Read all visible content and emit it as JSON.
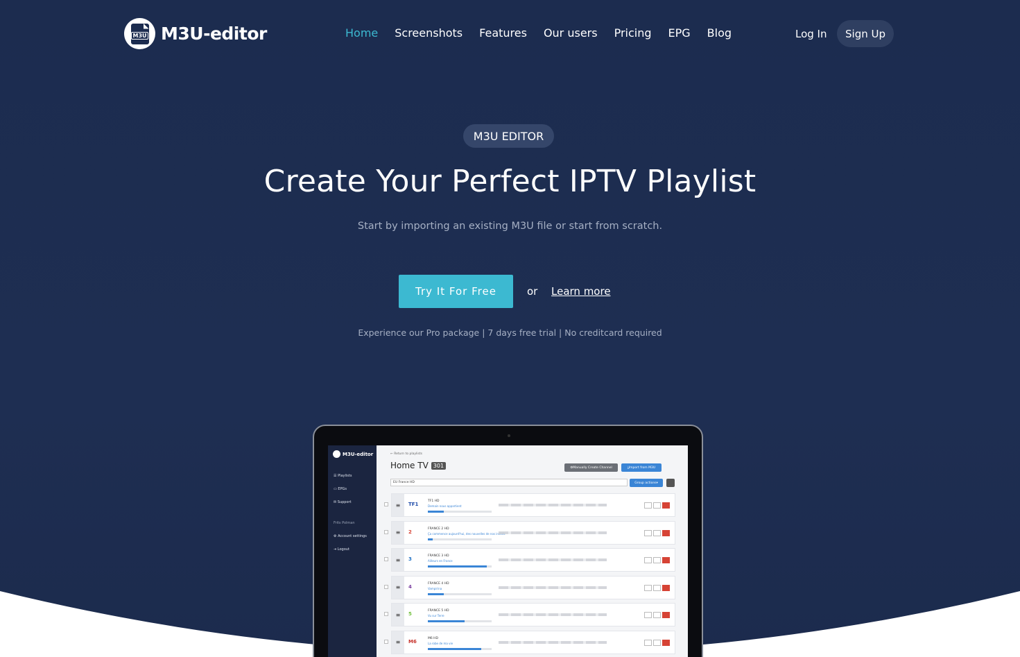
{
  "brand": {
    "name": "M3U-editor",
    "icon_text": "M3U"
  },
  "nav": {
    "items": [
      {
        "label": "Home",
        "active": true
      },
      {
        "label": "Screenshots",
        "active": false
      },
      {
        "label": "Features",
        "active": false
      },
      {
        "label": "Our users",
        "active": false
      },
      {
        "label": "Pricing",
        "active": false
      },
      {
        "label": "EPG",
        "active": false
      },
      {
        "label": "Blog",
        "active": false
      }
    ],
    "login_label": "Log In",
    "signup_label": "Sign Up"
  },
  "hero": {
    "badge": "M3U EDITOR",
    "title": "Create Your Perfect IPTV Playlist",
    "subtitle": "Start by importing an existing M3U file or start from scratch.",
    "cta_label": "Try It For Free",
    "or_text": "or",
    "learn_more_label": "Learn more",
    "note": "Experience our Pro package | 7 days free trial | No creditcard required"
  },
  "preview": {
    "app_name": "M3U-editor",
    "sidebar": [
      {
        "label": "Playlists"
      },
      {
        "label": "EPGs"
      },
      {
        "label": "Support"
      },
      {
        "label": "Frits Polman"
      },
      {
        "label": "Account settings"
      },
      {
        "label": "Logout"
      }
    ],
    "back_link": "Return to playlists",
    "playlist_title": "Home TV",
    "playlist_count": "301",
    "manual_button": "Manually Create Channel",
    "import_button": "Import from M3U",
    "group_select": "EU France HD",
    "group_actions": "Group actions",
    "channels": [
      {
        "logo": "TF1",
        "name": "TF1 HD",
        "program": "Demain nous appartient",
        "progress": 0.25
      },
      {
        "logo": "2",
        "name": "FRANCE 2 HD",
        "program": "Ça commence aujourd'hui, des nouvelles de nos invités",
        "progress": 0.08
      },
      {
        "logo": "3",
        "name": "FRANCE 3 HD",
        "program": "Ailleurs en France",
        "progress": 0.92
      },
      {
        "logo": "4",
        "name": "FRANCE 4 HD",
        "program": "Vampirina",
        "progress": 0.25
      },
      {
        "logo": "5",
        "name": "FRANCE 5 HD",
        "program": "Vu sur Terre",
        "progress": 0.58
      },
      {
        "logo": "M6",
        "name": "M6 HD",
        "program": "La robe de ma vie",
        "progress": 0.84
      }
    ]
  },
  "colors": {
    "background": "#1c2c4f",
    "accent": "#3cb9d1",
    "muted_text": "#a6b0c4",
    "pill": "#35466a"
  }
}
